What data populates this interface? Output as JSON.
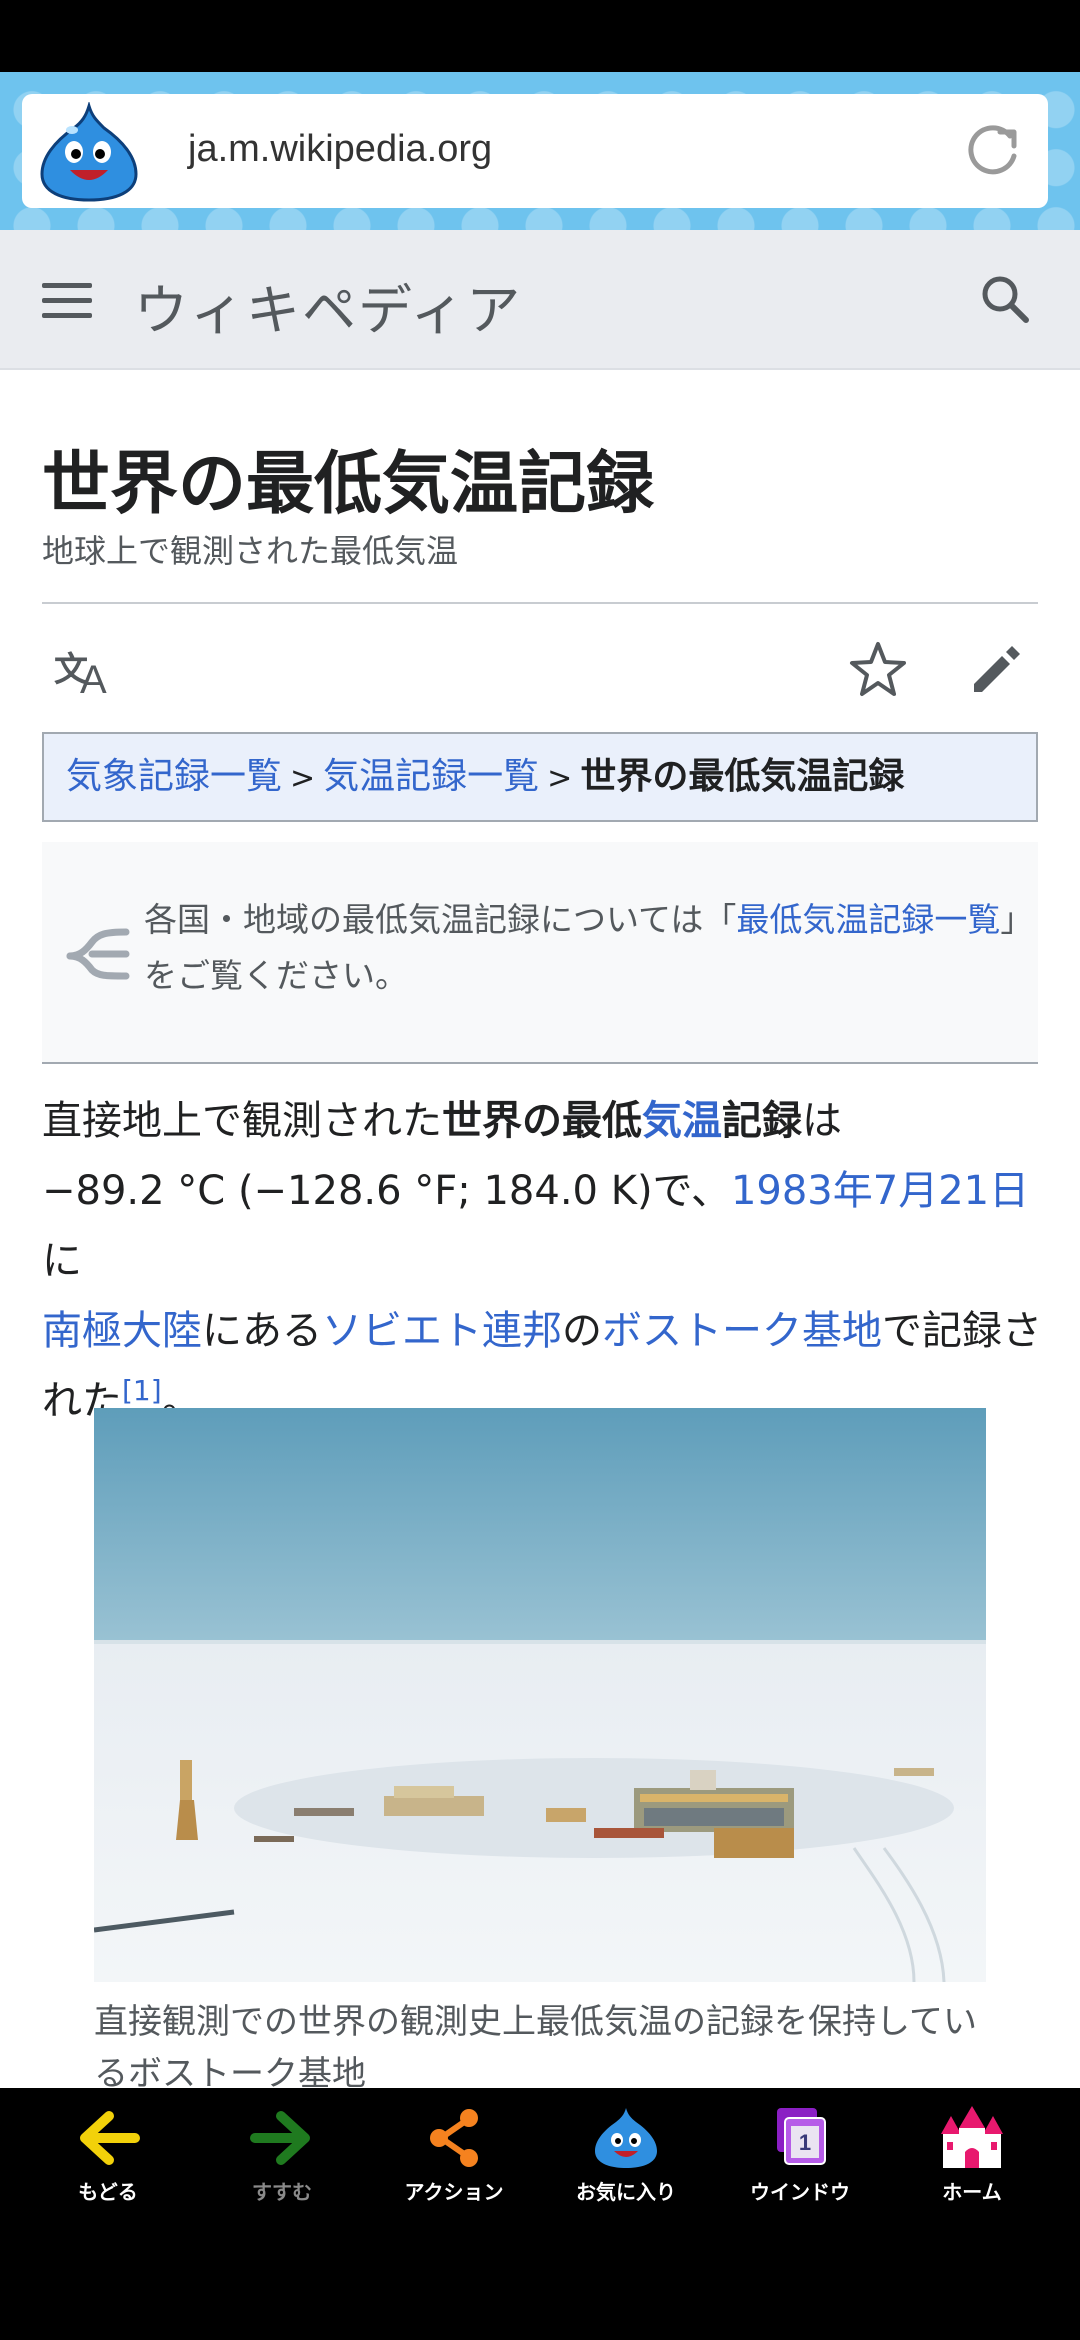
{
  "browser": {
    "url": "ja.m.wikipedia.org"
  },
  "header": {
    "logo_text": "ウィキペディア"
  },
  "article": {
    "title": "世界の最低気温記録",
    "subtitle": "地球上で観測された最低気温",
    "breadcrumb": {
      "item1": "気象記録一覧",
      "sep": ">",
      "item2": "気温記録一覧",
      "current": "世界の最低気温記録"
    },
    "hatnote": {
      "pre": "各国・地域の最低気温記録については「",
      "link": "最低気温記録一覧",
      "post": "」をご覧ください。"
    },
    "lead": {
      "t1": "直接地上で観測された",
      "b1": "世界の最低",
      "l1": "気温",
      "b2": "記録",
      "t2": "は",
      "t3": "−89.2 °C (−128.6 °F; 184.0 K)で、",
      "l2": "1983年7月21日",
      "t4": "に",
      "l3": "南極大陸",
      "t5": "にある",
      "l4": "ソビエト連邦",
      "t6": "の",
      "l5": "ボストーク基地",
      "t7": "で記録された",
      "ref": "[1]",
      "t8": "。"
    },
    "figure_caption": "直接観測での世界の観測史上最低気温の記録を保持しているボストーク基地"
  },
  "toolbar": {
    "back": "もどる",
    "forward": "すすむ",
    "action": "アクション",
    "favorites": "お気に入り",
    "window": "ウインドウ",
    "window_count": "1",
    "home": "ホーム"
  },
  "colors": {
    "link": "#3366cc",
    "header_bg": "#eaecf0",
    "url_area_bg": "#6ec3ee",
    "back_arrow": "#f2d10a",
    "forward_arrow": "#1f7a1f",
    "action": "#f5821f",
    "window": "#8b1fc4",
    "home": "#e8196e"
  }
}
